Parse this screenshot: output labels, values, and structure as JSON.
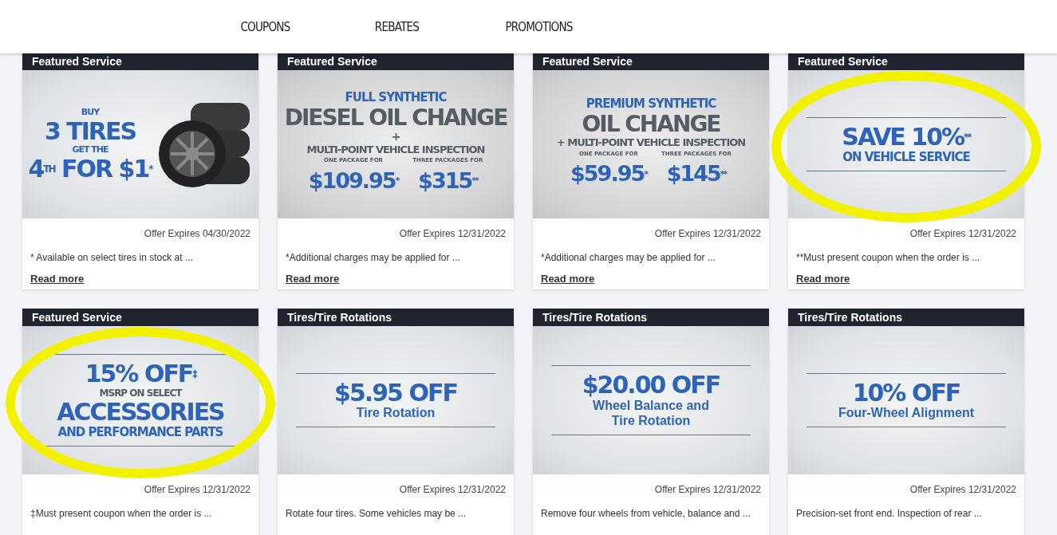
{
  "nav": {
    "tabs": [
      "COUPONS",
      "REBATES",
      "PROMOTIONS"
    ]
  },
  "cards": [
    {
      "category": "Featured Service",
      "highlighted": false,
      "banner": {
        "kind": "tires",
        "lines": [
          {
            "kind": "kicker",
            "text": "BUY"
          },
          {
            "kind": "headline",
            "text": "3 TIRES"
          },
          {
            "kind": "kicker",
            "text": "GET THE"
          },
          {
            "kind": "headline",
            "text": "4$^{TH}$ FOR $1$^{*}$"
          }
        ]
      },
      "expires": "Offer Expires 04/30/2022",
      "description": "* Available on select tires in stock at ...",
      "link": "Read more"
    },
    {
      "category": "Featured Service",
      "highlighted": false,
      "banner": {
        "kind": "center",
        "lines": [
          {
            "kind": "subline",
            "text": "FULL SYNTHETIC"
          },
          {
            "kind": "grey-headline",
            "text": "DIESEL OIL CHANGE"
          },
          {
            "kind": "plus",
            "text": "+"
          },
          {
            "kind": "grey-subline",
            "text": "MULTI-POINT VEHICLE INSPECTION"
          }
        ],
        "prices": [
          {
            "caption": "ONE PACKAGE FOR",
            "amount": "$109.95$^{*}$"
          },
          {
            "caption": "THREE PACKAGES FOR",
            "amount": "$315$^{**}$"
          }
        ]
      },
      "expires": "Offer Expires 12/31/2022",
      "description": "*Additional charges may be applied for ...",
      "link": "Read more"
    },
    {
      "category": "Featured Service",
      "highlighted": false,
      "banner": {
        "kind": "center",
        "lines": [
          {
            "kind": "subline",
            "text": "PREMIUM SYNTHETIC"
          },
          {
            "kind": "grey-headline",
            "text": "OIL CHANGE"
          },
          {
            "kind": "grey-subline",
            "text": "+ MULTI-POINT VEHICLE INSPECTION"
          }
        ],
        "prices": [
          {
            "caption": "ONE PACKAGE FOR",
            "amount": "$59.95$^{*}$"
          },
          {
            "caption": "THREE PACKAGES FOR",
            "amount": "$145$^{**}$"
          }
        ]
      },
      "expires": "Offer Expires 12/31/2022",
      "description": "*Additional charges may be applied for ...",
      "link": "Read more"
    },
    {
      "category": "Featured Service",
      "highlighted": true,
      "banner": {
        "kind": "ruled",
        "lines": [
          {
            "kind": "headline",
            "text": "SAVE 10%$^{**}$"
          },
          {
            "kind": "subline",
            "text": "ON VEHICLE SERVICE"
          }
        ]
      },
      "expires": "Offer Expires 12/31/2022",
      "description": "**Must present coupon when the order is ...",
      "link": "Read more"
    },
    {
      "category": "Featured Service",
      "highlighted": true,
      "banner": {
        "kind": "ruled",
        "lines": [
          {
            "kind": "headline",
            "text": "15% OFF$^{‡}$"
          },
          {
            "kind": "grey-caption",
            "text": "MSRP ON SELECT"
          },
          {
            "kind": "headline",
            "text": "ACCESSORIES"
          },
          {
            "kind": "subline",
            "text": "AND PERFORMANCE PARTS"
          }
        ]
      },
      "expires": "Offer Expires 12/31/2022",
      "description": "‡Must present coupon when the order is ..."
    },
    {
      "category": "Tires/Tire Rotations",
      "highlighted": false,
      "banner": {
        "kind": "ruled",
        "lines": [
          {
            "kind": "headline",
            "text": "$5.95 OFF"
          },
          {
            "kind": "label",
            "text": "Tire Rotation"
          }
        ]
      },
      "expires": "Offer Expires 12/31/2022",
      "description": "Rotate four tires. Some vehicles may be ..."
    },
    {
      "category": "Tires/Tire Rotations",
      "highlighted": false,
      "banner": {
        "kind": "ruled",
        "lines": [
          {
            "kind": "headline",
            "text": "$20.00 OFF"
          },
          {
            "kind": "label",
            "text": "Wheel Balance and"
          },
          {
            "kind": "label",
            "text": "Tire Rotation"
          }
        ]
      },
      "expires": "Offer Expires 12/31/2022",
      "description": "Remove four wheels from vehicle, balance and ..."
    },
    {
      "category": "Tires/Tire Rotations",
      "highlighted": false,
      "banner": {
        "kind": "ruled",
        "lines": [
          {
            "kind": "headline",
            "text": "10% OFF"
          },
          {
            "kind": "label",
            "text": "Four-Wheel Alignment"
          }
        ]
      },
      "expires": "Offer Expires 12/31/2022",
      "description": "Precision-set front end. Inspection of rear ..."
    }
  ]
}
